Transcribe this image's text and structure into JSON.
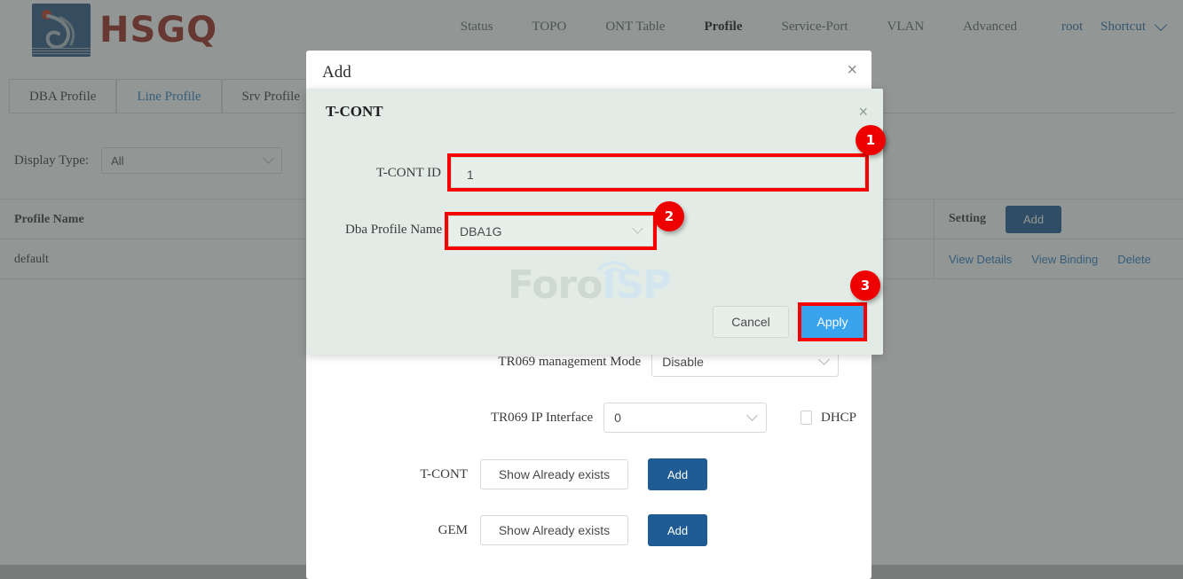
{
  "header": {
    "brand": "HSGQ",
    "nav": [
      {
        "label": "Status",
        "active": false
      },
      {
        "label": "TOPO",
        "active": false
      },
      {
        "label": "ONT Table",
        "active": false
      },
      {
        "label": "Profile",
        "active": true
      },
      {
        "label": "Service-Port",
        "active": false
      },
      {
        "label": "VLAN",
        "active": false
      },
      {
        "label": "Advanced",
        "active": false
      }
    ],
    "user": "root",
    "shortcut": "Shortcut"
  },
  "tabs": [
    {
      "label": "DBA Profile",
      "active": false
    },
    {
      "label": "Line Profile",
      "active": true
    },
    {
      "label": "Srv Profile",
      "active": false
    }
  ],
  "filter": {
    "label": "Display Type:",
    "value": "All"
  },
  "table": {
    "columns": [
      "Profile Name",
      "Setting"
    ],
    "header_action": "Add",
    "rows": [
      {
        "profile_name": "default",
        "actions": [
          "View Details",
          "View Binding",
          "Delete"
        ]
      }
    ]
  },
  "add_modal": {
    "title": "Add",
    "close": "×",
    "fields": [
      {
        "label": "TR069 management Mode",
        "value": "Disable"
      },
      {
        "label": "TR069 IP Interface",
        "value": "0",
        "checkbox_label": "DHCP"
      },
      {
        "label": "T-CONT",
        "button": "Show Already exists",
        "add": "Add"
      },
      {
        "label": "GEM",
        "button": "Show Already exists",
        "add": "Add"
      }
    ]
  },
  "tcont_modal": {
    "title": "T-CONT",
    "close": "×",
    "tcont_id_label": "T-CONT ID",
    "tcont_id_value": "1",
    "dba_label": "Dba Profile Name",
    "dba_value": "DBA1G",
    "cancel": "Cancel",
    "apply": "Apply"
  },
  "watermark": {
    "part1": "Foro",
    "part2": "ISP"
  },
  "badges": [
    {
      "id": "1",
      "target": "tcont-id-input"
    },
    {
      "id": "2",
      "target": "dba-profile-select"
    },
    {
      "id": "3",
      "target": "apply-button"
    }
  ],
  "colors": {
    "brand_red": "#9e2a20",
    "logo_blue": "#2c5a85",
    "link_blue": "#2f7fc6",
    "button_blue": "#1f5c94",
    "apply_blue": "#3aa3ee",
    "highlight_red": "#f60000",
    "modal_mint": "#e2ebe6"
  }
}
